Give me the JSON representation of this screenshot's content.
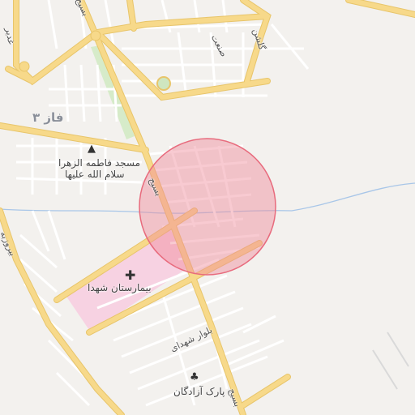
{
  "map": {
    "district_label": "فاز ۳",
    "poi": {
      "mosque": {
        "name_line1": "مسجد فاطمه الزهرا",
        "name_line2": "سلام الله علیها",
        "icon": "mosque-icon"
      },
      "hospital": {
        "name": "بیمارستان شهدا",
        "icon": "hospital-cross-icon"
      },
      "park": {
        "name": "پارک آزادگان",
        "icon": "tree-icon"
      }
    },
    "roads": {
      "basij": "بسیج",
      "basij_south": "بسیج",
      "basij_north": "بسیج",
      "shohada_blvd": "بلوار شهدای",
      "sanat": "صنعت",
      "golshan": "گلشن",
      "ghadir": "غدیر",
      "biroozbeh": "بیروزبه"
    },
    "colors": {
      "background": "#f3f1ee",
      "major_road": "#f7d98a",
      "major_road_casing": "#e8c56a",
      "minor_road": "#ffffff",
      "hospital_area": "#f7d2e2",
      "park_area": "#d6ebc9",
      "river": "#a8c6e8",
      "highlight_circle_fill": "#f08a9a",
      "highlight_circle_stroke": "#e86b7d"
    }
  }
}
